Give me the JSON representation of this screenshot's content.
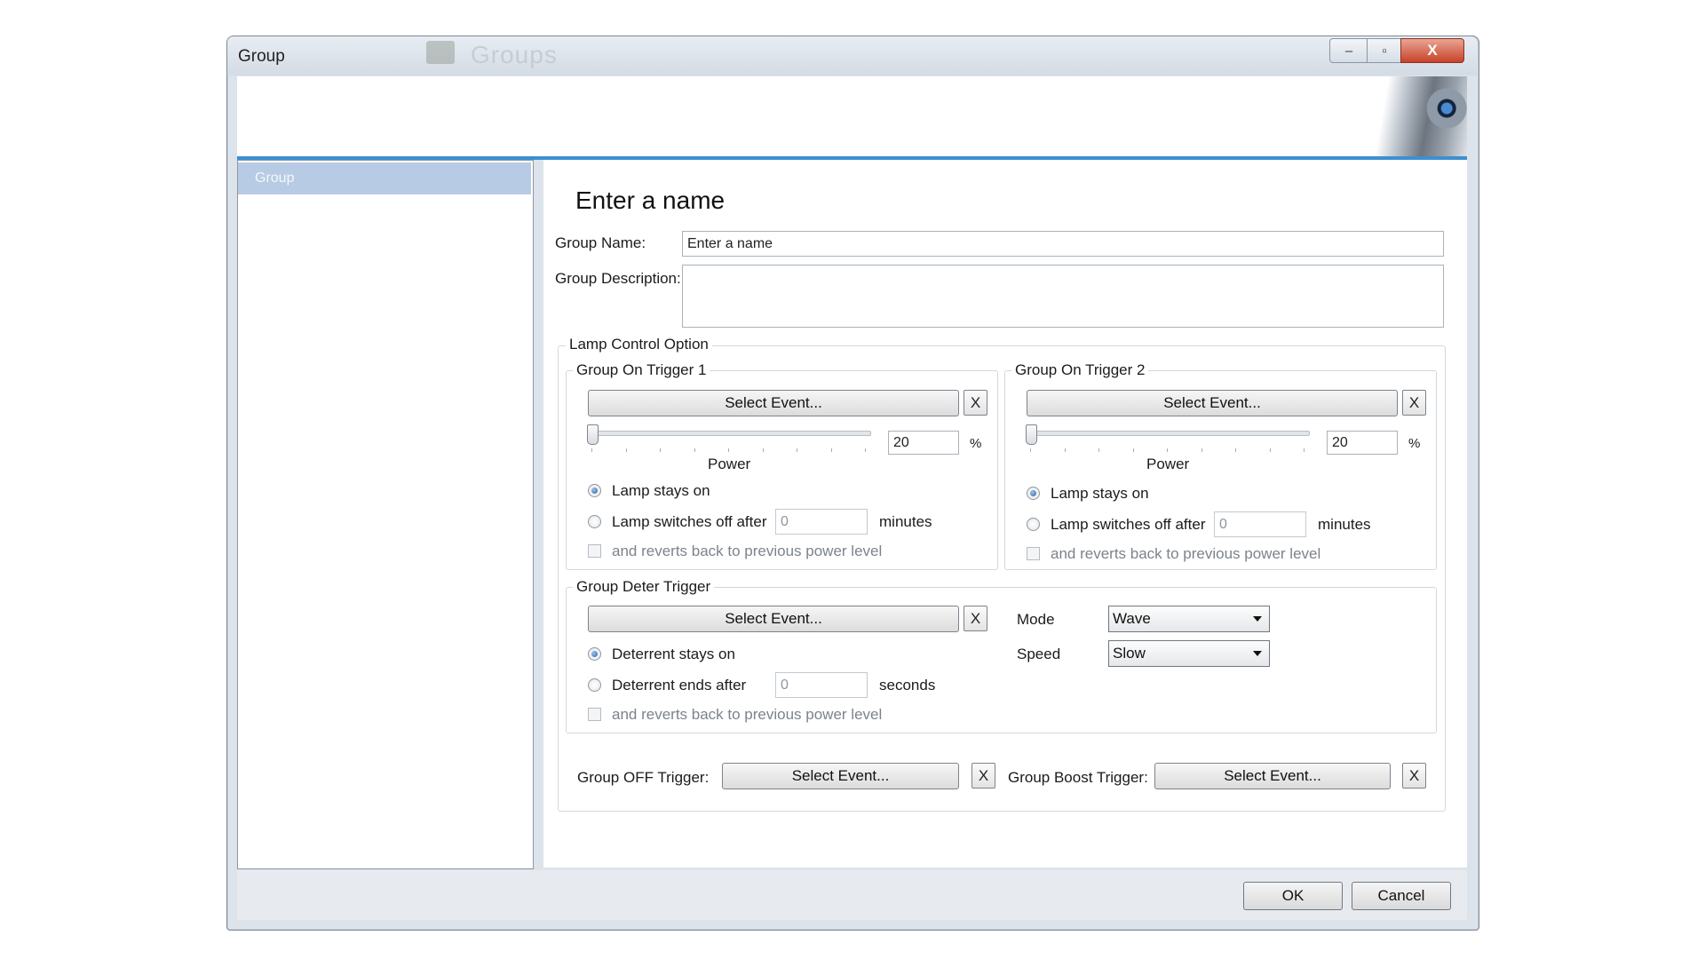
{
  "window": {
    "title": "Group",
    "ghost_title": "Groups",
    "close_glyph": "X",
    "max_glyph": "▫",
    "min_glyph": "–"
  },
  "sidebar": {
    "items": [
      {
        "label": "Group"
      }
    ]
  },
  "page": {
    "title": "Enter a name"
  },
  "form": {
    "group_name_label": "Group Name:",
    "group_name_value": "Enter a name",
    "group_description_label": "Group Description:",
    "group_description_value": ""
  },
  "lamp_control": {
    "title": "Lamp Control Option",
    "trigger1": {
      "title": "Group On Trigger 1",
      "select_event_label": "Select Event...",
      "clear_label": "X",
      "power_value": "20",
      "percent_label": "%",
      "power_label": "Power",
      "power_level": 0,
      "lamp_stays_on_label": "Lamp stays on",
      "lamp_switches_off_label": "Lamp switches off after",
      "minutes_value": "0",
      "minutes_label": "minutes",
      "reverts_label": "and reverts back to previous power level",
      "selected": "stays_on"
    },
    "trigger2": {
      "title": "Group On Trigger 2",
      "select_event_label": "Select Event...",
      "clear_label": "X",
      "power_value": "20",
      "percent_label": "%",
      "power_label": "Power",
      "power_level": 0,
      "lamp_stays_on_label": "Lamp stays on",
      "lamp_switches_off_label": "Lamp switches off after",
      "minutes_value": "0",
      "minutes_label": "minutes",
      "reverts_label": "and reverts back to previous power level",
      "selected": "stays_on"
    },
    "deter": {
      "title": "Group Deter Trigger",
      "select_event_label": "Select Event...",
      "clear_label": "X",
      "deterrent_stays_on_label": "Deterrent stays on",
      "deterrent_ends_label": "Deterrent ends after",
      "seconds_value": "0",
      "seconds_label": "seconds",
      "reverts_label": "and reverts back to previous power level",
      "mode_label": "Mode",
      "mode_value": "Wave",
      "speed_label": "Speed",
      "speed_value": "Slow"
    },
    "off_trigger": {
      "label": "Group OFF Trigger:",
      "select_event_label": "Select Event...",
      "clear_label": "X"
    },
    "boost_trigger": {
      "label": "Group Boost Trigger:",
      "select_event_label": "Select Event...",
      "clear_label": "X"
    }
  },
  "footer": {
    "ok_label": "OK",
    "cancel_label": "Cancel"
  }
}
